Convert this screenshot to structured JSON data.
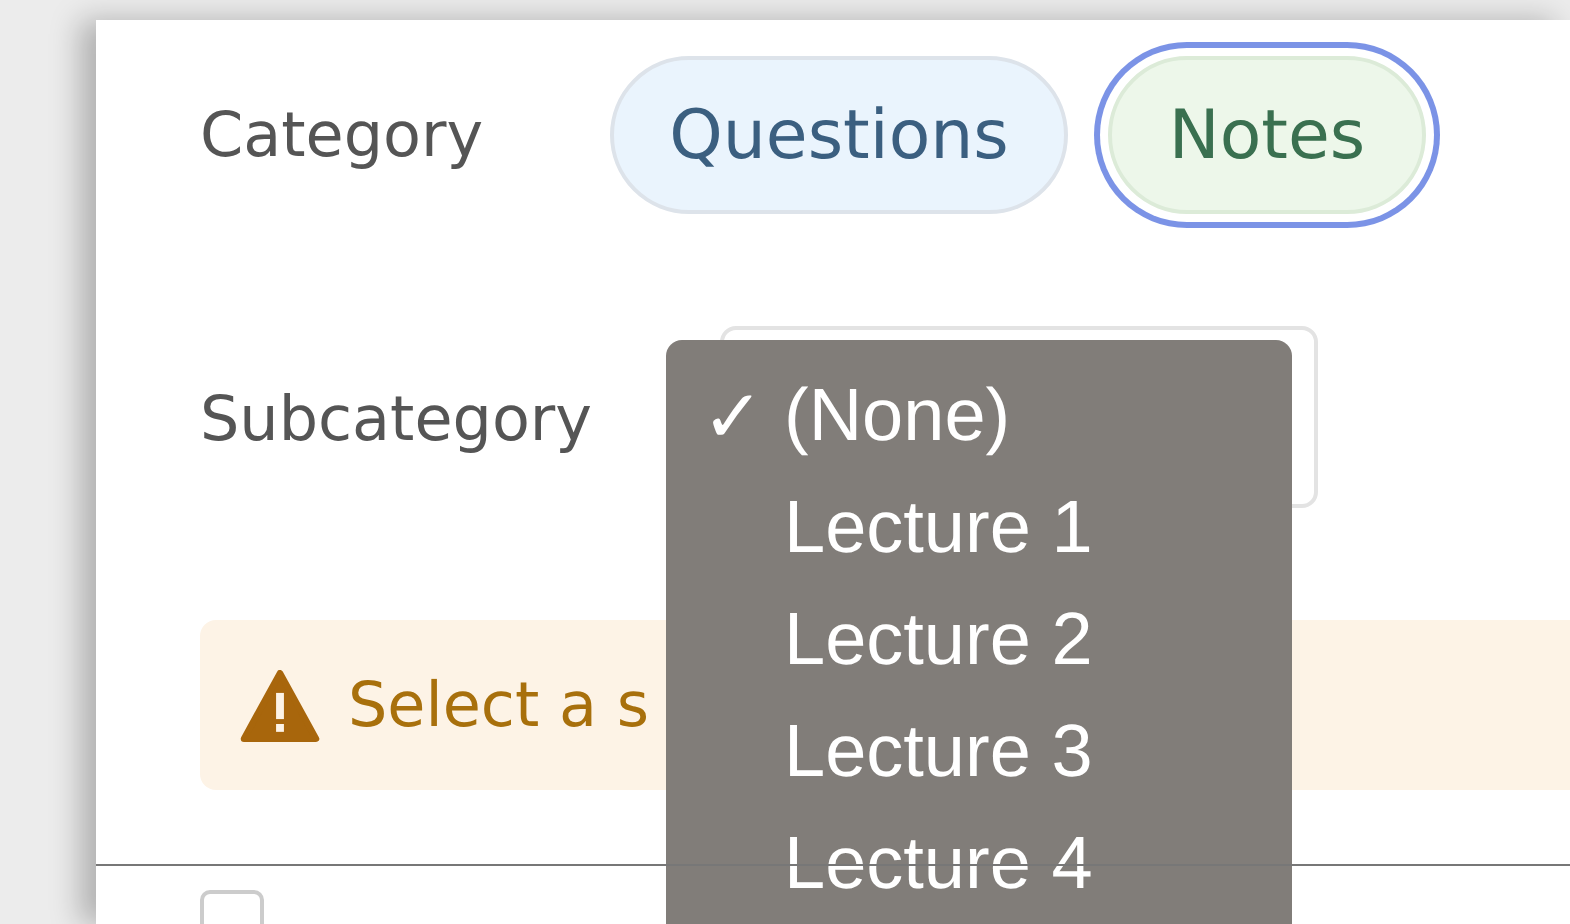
{
  "category": {
    "label": "Category",
    "options": [
      {
        "label": "Questions",
        "selected": false,
        "kind": "questions"
      },
      {
        "label": "Notes",
        "selected": true,
        "kind": "notes"
      }
    ]
  },
  "subcategory": {
    "label": "Subcategory",
    "check_mark": "✓",
    "menu": [
      {
        "label": "(None)",
        "selected": true
      },
      {
        "label": "Lecture 1",
        "selected": false
      },
      {
        "label": "Lecture 2",
        "selected": false
      },
      {
        "label": "Lecture 3",
        "selected": false
      },
      {
        "label": "Lecture 4",
        "selected": false
      }
    ]
  },
  "warning": {
    "text": "Select a s"
  },
  "checkbox": {
    "checked": false
  }
}
